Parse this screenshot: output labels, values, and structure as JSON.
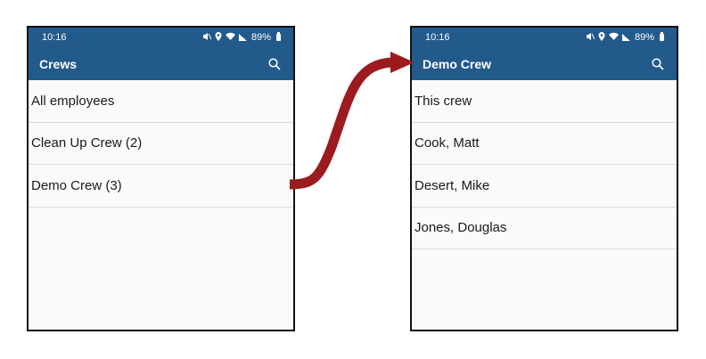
{
  "left_screen": {
    "status_time": "10:16",
    "battery_percent": "89%",
    "title": "Crews",
    "items": [
      {
        "label": "All employees"
      },
      {
        "label": "Clean Up Crew (2)"
      },
      {
        "label": "Demo Crew (3)"
      }
    ]
  },
  "right_screen": {
    "status_time": "10:16",
    "battery_percent": "89%",
    "title": "Demo Crew",
    "items": [
      {
        "label": "This crew"
      },
      {
        "label": "Cook, Matt"
      },
      {
        "label": "Desert, Mike"
      },
      {
        "label": "Jones, Douglas"
      }
    ]
  },
  "colors": {
    "app_bar": "#235a8c",
    "arrow": "#9b1b1f",
    "background": "#fafafa"
  },
  "icons": [
    "search-icon",
    "mute-icon",
    "location-icon",
    "wifi-icon",
    "signal-icon",
    "battery-icon"
  ]
}
